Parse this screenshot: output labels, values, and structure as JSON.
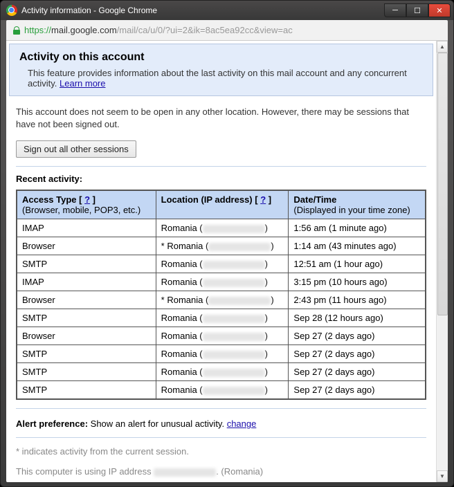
{
  "window": {
    "title": "Activity information - Google Chrome"
  },
  "url": {
    "scheme": "https",
    "domain": "mail.google.com",
    "path": "/mail/ca/u/0/?ui=2&ik=8ac5ea92cc&view=ac"
  },
  "header": {
    "title": "Activity on this account",
    "description": "This feature provides information about the last activity on this mail account and any concurrent activity. ",
    "learn_more": "Learn more"
  },
  "status": "This account does not seem to be open in any other location. However, there may be sessions that have not been signed out.",
  "signout_button": "Sign out all other sessions",
  "recent_activity_label": "Recent activity:",
  "table": {
    "headers": {
      "access_type": "Access Type",
      "access_type_sub": "(Browser, mobile, POP3, etc.)",
      "location": "Location (IP address)",
      "datetime": "Date/Time",
      "datetime_sub": "(Displayed in your time zone)",
      "qmark": "?"
    },
    "rows": [
      {
        "type": "IMAP",
        "loc_prefix": "Romania (",
        "datetime": "1:56 am (1 minute ago)"
      },
      {
        "type": "Browser",
        "loc_prefix": "* Romania (",
        "datetime": "1:14 am (43 minutes ago)"
      },
      {
        "type": "SMTP",
        "loc_prefix": "Romania (",
        "datetime": "12:51 am (1 hour ago)"
      },
      {
        "type": "IMAP",
        "loc_prefix": "Romania (",
        "datetime": "3:15 pm (10 hours ago)"
      },
      {
        "type": "Browser",
        "loc_prefix": "* Romania (",
        "datetime": "2:43 pm (11 hours ago)"
      },
      {
        "type": "SMTP",
        "loc_prefix": "Romania (",
        "datetime": "Sep 28 (12 hours ago)"
      },
      {
        "type": "Browser",
        "loc_prefix": "Romania (",
        "datetime": "Sep 27 (2 days ago)"
      },
      {
        "type": "SMTP",
        "loc_prefix": "Romania (",
        "datetime": "Sep 27 (2 days ago)"
      },
      {
        "type": "SMTP",
        "loc_prefix": "Romania (",
        "datetime": "Sep 27 (2 days ago)"
      },
      {
        "type": "SMTP",
        "loc_prefix": "Romania (",
        "datetime": "Sep 27 (2 days ago)"
      }
    ]
  },
  "alert": {
    "label": "Alert preference:",
    "text": " Show an alert for unusual activity. ",
    "change": "change"
  },
  "footnote": "* indicates activity from the current session.",
  "ip_line_prefix": "This computer is using IP address ",
  "ip_line_suffix": ". (Romania)"
}
